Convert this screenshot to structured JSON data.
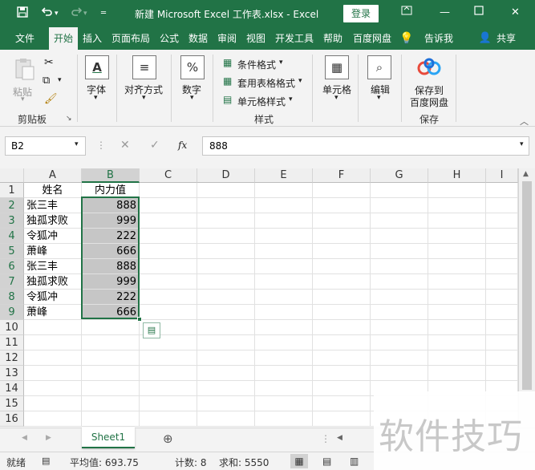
{
  "titlebar": {
    "save_icon": "save-icon",
    "undo_icon": "undo-icon",
    "redo_icon": "redo-icon",
    "customize_icon": "customize-qat-icon",
    "title": "新建 Microsoft Excel 工作表.xlsx  -  Excel",
    "login": "登录",
    "options_icon": "ribbon-display-options-icon",
    "minimize_icon": "minimize-icon",
    "maximize_icon": "maximize-icon",
    "close_icon": "close-icon"
  },
  "menu": {
    "tabs": [
      "文件",
      "开始",
      "插入",
      "页面布局",
      "公式",
      "数据",
      "审阅",
      "视图",
      "开发工具",
      "帮助",
      "百度网盘"
    ],
    "active": "开始",
    "tell_me": "告诉我",
    "share": "共享"
  },
  "ribbon": {
    "clipboard": {
      "paste": "粘贴",
      "label": "剪贴板"
    },
    "font": {
      "label": "字体"
    },
    "alignment": {
      "label": "对齐方式"
    },
    "number": {
      "label": "数字"
    },
    "styles": {
      "conditional": "条件格式",
      "table": "套用表格格式",
      "cell": "单元格样式",
      "label": "样式"
    },
    "cells": {
      "label": "单元格"
    },
    "editing": {
      "label": "编辑"
    },
    "save": {
      "label1": "保存到",
      "label2": "百度网盘",
      "group": "保存"
    }
  },
  "formula_bar": {
    "name_box": "B2",
    "fx": "fx",
    "value": "888"
  },
  "sheet": {
    "columns": [
      "A",
      "B",
      "C",
      "D",
      "E",
      "F",
      "G",
      "H",
      "I"
    ],
    "selected_column": "B",
    "rows": [
      {
        "num": "1",
        "a": "姓名",
        "b": "内力值"
      },
      {
        "num": "2",
        "a": "张三丰",
        "b": "888"
      },
      {
        "num": "3",
        "a": "独孤求败",
        "b": "999"
      },
      {
        "num": "4",
        "a": "令狐冲",
        "b": "222"
      },
      {
        "num": "5",
        "a": "萧峰",
        "b": "666"
      },
      {
        "num": "6",
        "a": "张三丰",
        "b": "888"
      },
      {
        "num": "7",
        "a": "独孤求败",
        "b": "999"
      },
      {
        "num": "8",
        "a": "令狐冲",
        "b": "222"
      },
      {
        "num": "9",
        "a": "萧峰",
        "b": "666"
      },
      {
        "num": "10",
        "a": "",
        "b": ""
      },
      {
        "num": "11",
        "a": "",
        "b": ""
      },
      {
        "num": "12",
        "a": "",
        "b": ""
      },
      {
        "num": "13",
        "a": "",
        "b": ""
      },
      {
        "num": "14",
        "a": "",
        "b": ""
      },
      {
        "num": "15",
        "a": "",
        "b": ""
      },
      {
        "num": "16",
        "a": "",
        "b": ""
      }
    ]
  },
  "tabs_bar": {
    "sheet_name": "Sheet1",
    "add_icon": "add-sheet-icon"
  },
  "status": {
    "mode": "就绪",
    "average": "平均值: 693.75",
    "count": "计数: 8",
    "sum": "求和: 5550"
  },
  "watermark": "软件技巧",
  "colors": {
    "accent": "#217346",
    "selection": "#c6c6c6"
  }
}
